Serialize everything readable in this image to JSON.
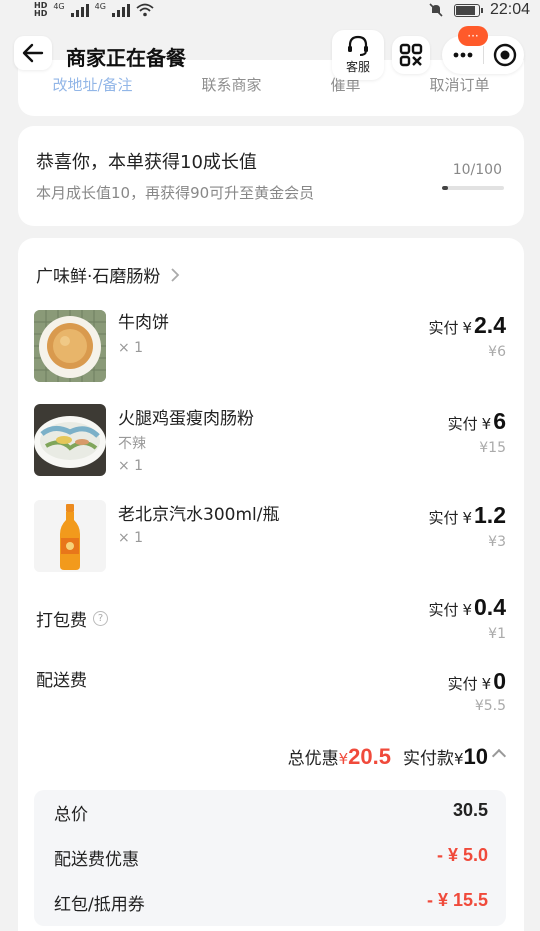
{
  "status_bar": {
    "network_tag": "HD",
    "signal1": "4G",
    "signal2": "4G",
    "time": "22:04"
  },
  "header": {
    "title": "商家正在备餐",
    "service_label": "客服",
    "badge": "···"
  },
  "top_card": {
    "actions": [
      "改地址/备注",
      "联系商家",
      "催单",
      "取消订单"
    ]
  },
  "growth": {
    "title": "恭喜你，本单获得10成长值",
    "subtitle": "本月成长值10，再获得90可升至黄金会员",
    "count": "10/100",
    "progress_percent": 10
  },
  "order": {
    "shop_name": "广味鲜·石磨肠粉",
    "items": [
      {
        "name": "牛肉饼",
        "spec": "",
        "qty": "× 1",
        "pay_label": "实付",
        "pay_currency": "¥",
        "pay_amount": "2.4",
        "orig": "¥6"
      },
      {
        "name": "火腿鸡蛋瘦肉肠粉",
        "spec": "不辣",
        "qty": "× 1",
        "pay_label": "实付",
        "pay_currency": "¥",
        "pay_amount": "6",
        "orig": "¥15"
      },
      {
        "name": "老北京汽水300ml/瓶",
        "spec": "",
        "qty": "× 1",
        "pay_label": "实付",
        "pay_currency": "¥",
        "pay_amount": "1.2",
        "orig": "¥3"
      }
    ],
    "fees": [
      {
        "name": "打包费",
        "pay_label": "实付",
        "pay_currency": "¥",
        "pay_amount": "0.4",
        "orig": "¥1"
      },
      {
        "name": "配送费",
        "pay_label": "实付",
        "pay_currency": "¥",
        "pay_amount": "0",
        "orig": "¥5.5"
      }
    ],
    "summary": {
      "discount_label": "总优惠",
      "discount_currency": "¥",
      "discount_amount": "20.5",
      "paid_label": "实付款",
      "paid_currency": "¥",
      "paid_amount": "10"
    },
    "breakdown": [
      {
        "label": "总价",
        "value": "30.5"
      },
      {
        "label": "配送费优惠",
        "value": "- ¥ 5.0"
      },
      {
        "label": "红包/抵用券",
        "value": "- ¥ 15.5"
      }
    ]
  },
  "colors": {
    "accent_red": "#f04a3b",
    "badge_orange": "#ff5a2a",
    "background": "#f2f2f2"
  },
  "icons": {
    "back": "arrow-left-icon",
    "service": "headset-icon",
    "qr": "qr-code-icon",
    "more": "more-dots-icon",
    "target": "target-circle-icon",
    "shop_chevron": "chevron-right-icon",
    "help": "question-circle-icon",
    "collapse": "chevron-up-icon"
  }
}
